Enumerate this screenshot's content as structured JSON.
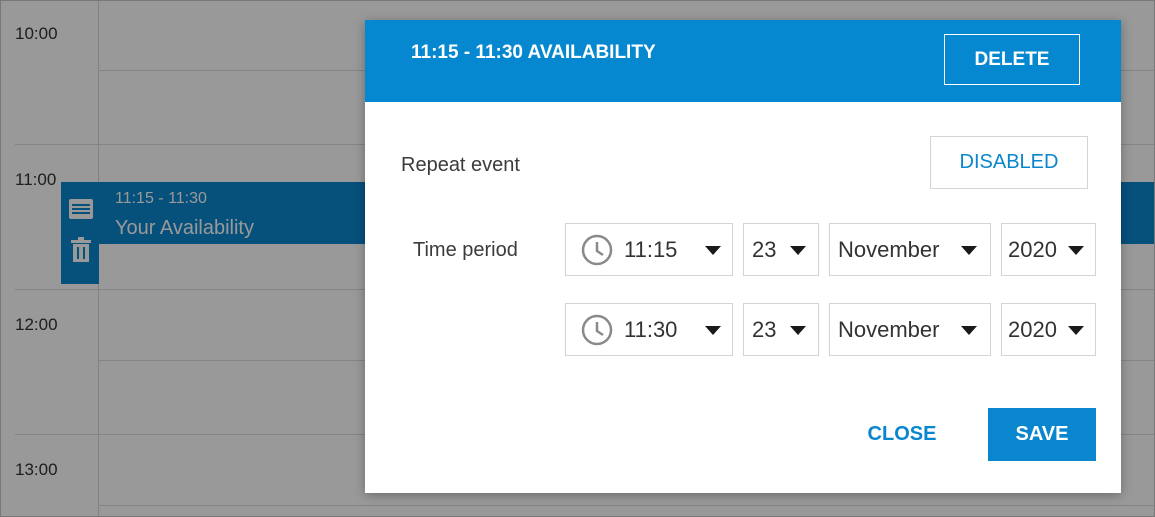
{
  "calendar": {
    "hours": [
      "10:00",
      "11:00",
      "12:00",
      "13:00"
    ],
    "event": {
      "time": "11:15 - 11:30",
      "title": "Your Availability",
      "icons": [
        "list-icon",
        "trash-icon"
      ]
    }
  },
  "modal": {
    "title": "11:15 - 11:30 AVAILABILITY",
    "delete_label": "DELETE",
    "repeat": {
      "label": "Repeat event",
      "value": "DISABLED"
    },
    "time_period": {
      "label": "Time period",
      "start": {
        "time": "11:15",
        "day": "23",
        "month": "November",
        "year": "2020"
      },
      "end": {
        "time": "11:30",
        "day": "23",
        "month": "November",
        "year": "2020"
      }
    },
    "close_label": "CLOSE",
    "save_label": "SAVE"
  },
  "colors": {
    "accent": "#0a86cf",
    "header": "#0688d1",
    "overlay": "rgba(0,0,0,0.40)"
  }
}
